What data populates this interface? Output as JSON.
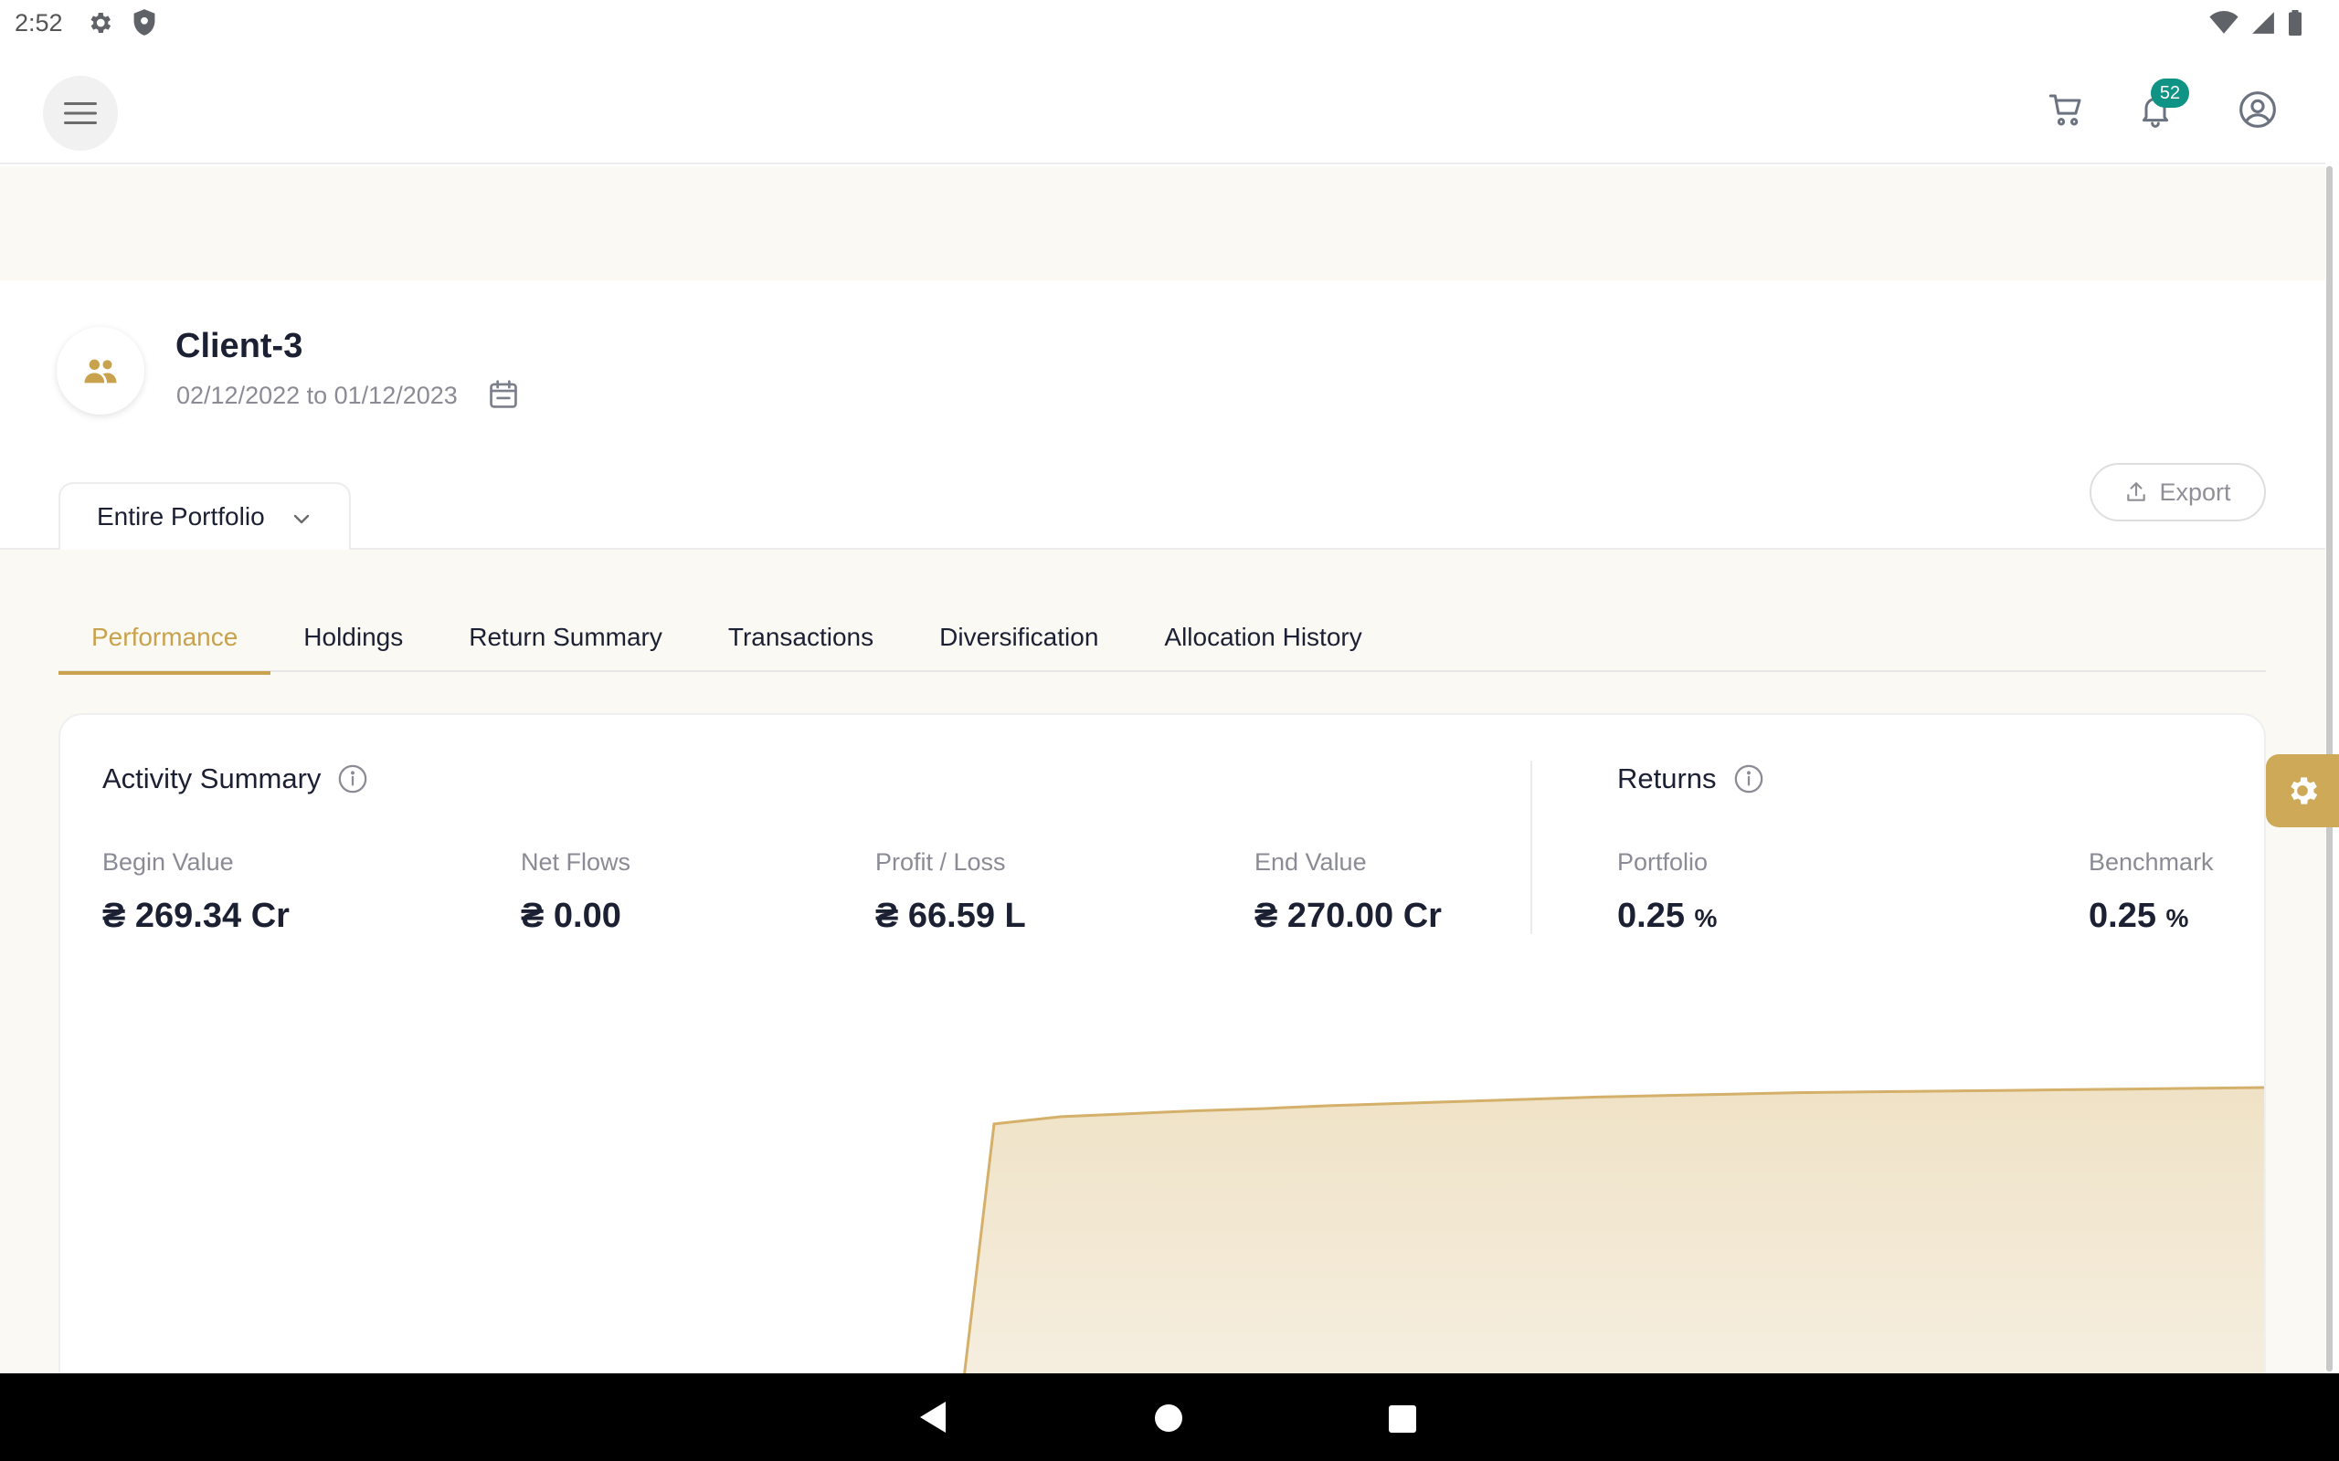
{
  "status_bar": {
    "time": "2:52",
    "left_icons": [
      "gear-icon",
      "shield-icon"
    ],
    "right_icons": [
      "wifi-icon",
      "signal-icon",
      "battery-icon"
    ]
  },
  "app_bar": {
    "menu_icon": "hamburger-menu-icon",
    "notification_count": "52",
    "icons": [
      "cart-icon",
      "bell-icon",
      "account-icon"
    ]
  },
  "client": {
    "name": "Client-3",
    "date_range": "02/12/2022 to 01/12/2023",
    "avatar_icon": "people-icon"
  },
  "export_label": "Export",
  "portfolio_selector": {
    "selected": "Entire Portfolio"
  },
  "tabs": [
    {
      "label": "Performance",
      "active": true
    },
    {
      "label": "Holdings",
      "active": false
    },
    {
      "label": "Return Summary",
      "active": false
    },
    {
      "label": "Transactions",
      "active": false
    },
    {
      "label": "Diversification",
      "active": false
    },
    {
      "label": "Allocation History",
      "active": false
    }
  ],
  "activity_summary": {
    "title": "Activity Summary",
    "stats": [
      {
        "label": "Begin Value",
        "value": "₴ 269.34 Cr"
      },
      {
        "label": "Net Flows",
        "value": "₴ 0.00"
      },
      {
        "label": "Profit / Loss",
        "value": "₴ 66.59 L"
      },
      {
        "label": "End Value",
        "value": "₴ 270.00 Cr"
      }
    ]
  },
  "returns": {
    "title": "Returns",
    "stats": [
      {
        "label": "Portfolio",
        "value": "0.25",
        "unit": "%"
      },
      {
        "label": "Benchmark",
        "value": "0.25",
        "unit": "%"
      }
    ]
  },
  "colors": {
    "accent": "#c9a24e",
    "badge": "#0f9384",
    "text_dark": "#1c2033",
    "text_muted": "#8b8b95",
    "area_fill": "#f3e9d7",
    "area_line": "#d4b06a"
  },
  "chart_data": {
    "type": "area",
    "x": [
      0,
      1,
      2,
      3,
      4,
      5,
      6,
      7,
      8,
      9,
      10,
      11,
      12,
      13,
      14,
      15,
      16,
      17,
      18,
      19,
      20
    ],
    "values": [
      0,
      0,
      0,
      0,
      0,
      0,
      0,
      0,
      0,
      0,
      0,
      0,
      0,
      0,
      0,
      0,
      0,
      0,
      0,
      0,
      0
    ],
    "series": [
      {
        "values": [
          0,
          95,
          96,
          96.4,
          96.8,
          97.1,
          97.5,
          97.8,
          98.1,
          98.4,
          98.7,
          98.9,
          99.1,
          99.3,
          99.4,
          99.5,
          99.6,
          99.7,
          99.8,
          99.9,
          100
        ]
      }
    ],
    "grid": false,
    "xlabel": "",
    "ylabel": ""
  }
}
